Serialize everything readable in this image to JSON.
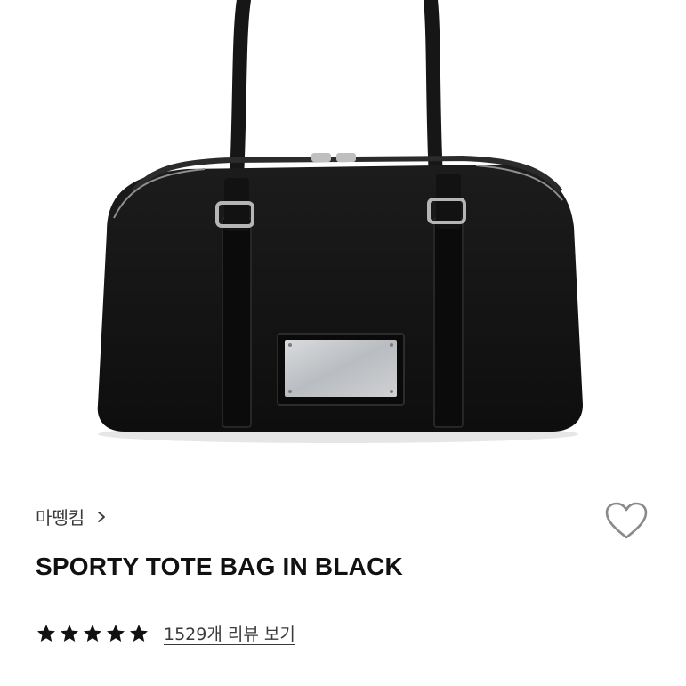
{
  "product": {
    "brand": "마뗑킴",
    "title": "SPORTY TOTE BAG IN BLACK",
    "rating": {
      "stars": 5,
      "max": 5
    },
    "reviews_link": "1529개 리뷰 보기"
  },
  "icons": {
    "brand_chevron": "chevron-right-icon",
    "wishlist": "heart-outline-icon",
    "star": "star-filled-icon"
  },
  "colors": {
    "bag": "#141414",
    "text": "#111111",
    "subtext": "#3a3a3a",
    "icon_gray": "#8a8a8a"
  }
}
